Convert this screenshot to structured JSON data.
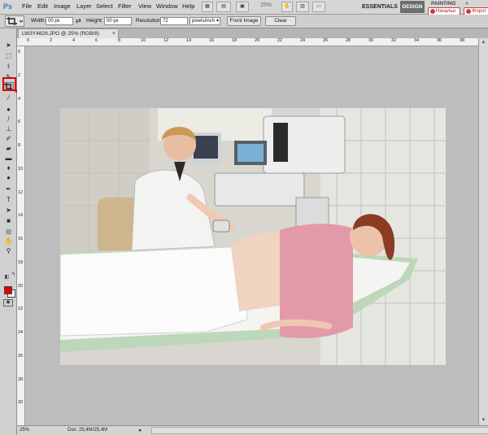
{
  "app": {
    "logo": "Ps",
    "menu": [
      "File",
      "Edit",
      "Image",
      "Layer",
      "Select",
      "Filter",
      "View",
      "Window",
      "Help"
    ],
    "zoom_level": "25%",
    "workspaces": {
      "essentials": "ESSENTIALS",
      "design": "DESIGN",
      "painting": "PAINTING"
    },
    "browser_tabs": [
      "Начальн",
      "Жорот"
    ],
    "minimize": "»"
  },
  "options_bar": {
    "width_label": "Width:",
    "width_value": "00 px",
    "height_label": "Height:",
    "height_value": "00 px",
    "resolution_label": "Resolution:",
    "resolution_value": "72",
    "resolution_unit": "pixels/inch",
    "front_image_label": "Front Image",
    "clear_label": "Clear"
  },
  "document": {
    "tab_title": "LW3Y4829.JPG @ 25% (RGB/8)",
    "close_glyph": "×",
    "ruler_h": [
      "0",
      "2",
      "4",
      "6",
      "8",
      "10",
      "12",
      "14",
      "16",
      "18",
      "20",
      "22",
      "24",
      "26",
      "28",
      "30",
      "32",
      "34",
      "36",
      "38"
    ],
    "ruler_v": [
      "0",
      "2",
      "4",
      "6",
      "8",
      "10",
      "12",
      "14",
      "16",
      "18",
      "20",
      "22",
      "24",
      "26",
      "28",
      "30"
    ]
  },
  "status": {
    "zoom": "25%",
    "doc_info": "Doc: 25,4M/25,4M"
  },
  "tools": {
    "active_tool": "crop-tool",
    "foreground_color": "#e10000",
    "background_color": "#ffffff"
  },
  "annotation": {
    "color": "#e00000"
  }
}
